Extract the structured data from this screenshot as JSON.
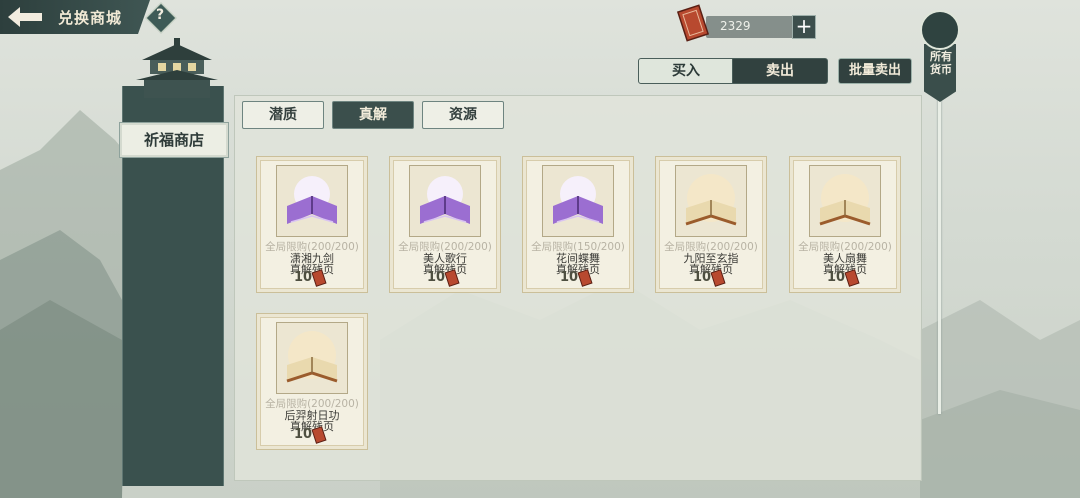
{
  "header": {
    "title": "兑换商城",
    "help_label": "?"
  },
  "currency": {
    "amount": "2329",
    "add_label": "+"
  },
  "trade_tabs": {
    "buy": "买入",
    "sell": "卖出",
    "active": "sell"
  },
  "batch_sell_label": "批量卖出",
  "all_currency_label": "所有货币",
  "sidebar": {
    "items": [
      {
        "label": "祈福商店",
        "active": true
      }
    ]
  },
  "category_tabs": [
    {
      "label": "潜质",
      "active": false
    },
    {
      "label": "真解",
      "active": true
    },
    {
      "label": "资源",
      "active": false
    }
  ],
  "items": [
    {
      "limit": "全局限购(200/200)",
      "name": "潇湘九剑",
      "currency": "真解残页",
      "price": "10",
      "icon": "purple-book-icon"
    },
    {
      "limit": "全局限购(200/200)",
      "name": "美人歌行",
      "currency": "真解残页",
      "price": "10",
      "icon": "purple-book-icon"
    },
    {
      "limit": "全局限购(150/200)",
      "name": "花间蝶舞",
      "currency": "真解残页",
      "price": "10",
      "icon": "purple-book-icon"
    },
    {
      "limit": "全局限购(200/200)",
      "name": "九阳至玄指",
      "currency": "真解残页",
      "price": "10",
      "icon": "gold-book-icon"
    },
    {
      "limit": "全局限购(200/200)",
      "name": "美人扇舞",
      "currency": "真解残页",
      "price": "10",
      "icon": "gold-book-icon"
    },
    {
      "limit": "全局限购(200/200)",
      "name": "后羿射日功",
      "currency": "真解残页",
      "price": "10",
      "icon": "gold-book-icon"
    }
  ],
  "colors": {
    "accent_dark": "#3b4f4c",
    "ticket_red": "#b8492f",
    "paper": "#f3f0e2"
  }
}
